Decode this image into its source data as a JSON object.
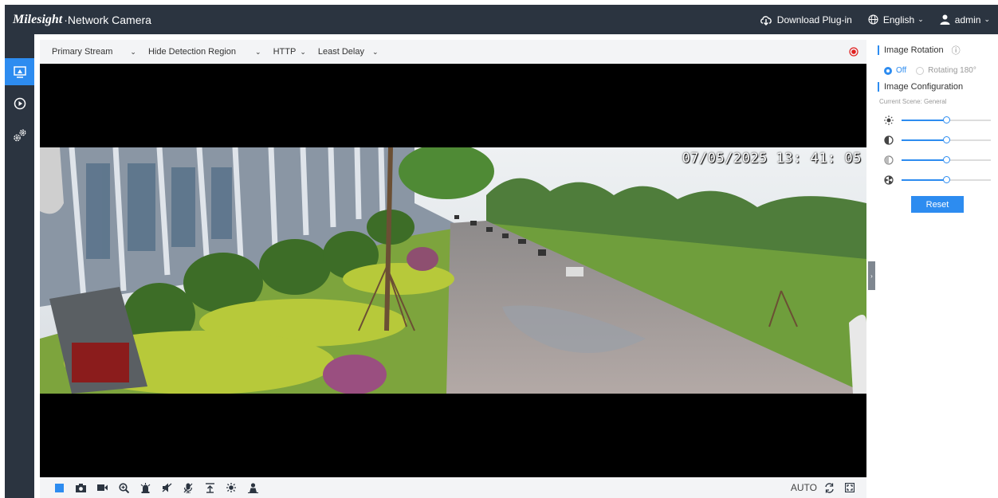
{
  "header": {
    "brand_logo": "Milesight",
    "brand_title": "Network Camera",
    "download": "Download Plug-in",
    "language": "English",
    "user": "admin"
  },
  "nav": {
    "items": [
      {
        "name": "live-view",
        "icon": "monitor-icon",
        "active": true
      },
      {
        "name": "playback",
        "icon": "play-circle-icon",
        "active": false
      },
      {
        "name": "settings",
        "icon": "gears-icon",
        "active": false
      }
    ]
  },
  "toolbar": {
    "stream": "Primary Stream",
    "detection": "Hide Detection Region",
    "protocol": "HTTP",
    "delay": "Least Delay"
  },
  "video": {
    "osd_time": "07/05/2025  13: 41: 05"
  },
  "bottombar": {
    "icons": [
      "stop-icon",
      "snapshot-icon",
      "record-icon",
      "zoom-icon",
      "alarm-icon",
      "audio-icon",
      "talk-icon",
      "upload-icon",
      "ir-icon",
      "person-icon"
    ],
    "mode": "AUTO"
  },
  "panel": {
    "rotation_title": "Image Rotation",
    "rotation_off": "Off",
    "rotation_180": "Rotating 180°",
    "config_title": "Image Configuration",
    "scene_label": "Current Scene: General",
    "sliders": [
      {
        "name": "brightness",
        "icon": "sun-icon",
        "value": 50
      },
      {
        "name": "contrast",
        "icon": "contrast-icon",
        "value": 50
      },
      {
        "name": "saturation",
        "icon": "saturation-icon",
        "value": 50
      },
      {
        "name": "sharpness",
        "icon": "sharpness-icon",
        "value": 50
      }
    ],
    "reset": "Reset"
  },
  "colors": {
    "accent": "#2d8cf0",
    "header_bg": "#2b3440",
    "record_red": "#e02020"
  }
}
